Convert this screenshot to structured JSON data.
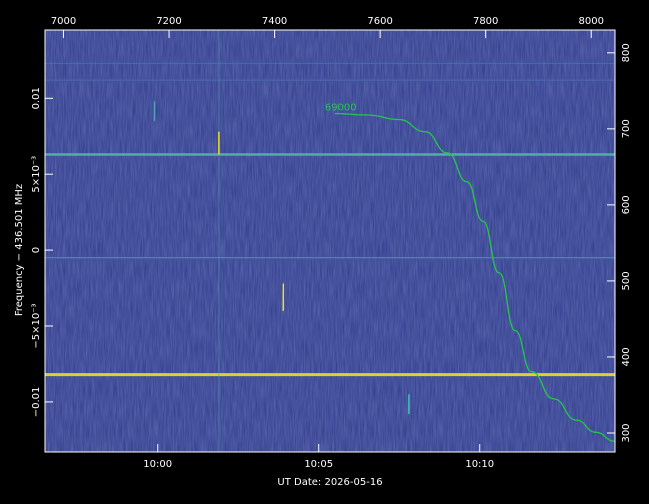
{
  "chart_data": {
    "type": "heatmap",
    "title": "",
    "xlabel": "UT Date: 2026-05-16",
    "ylabel_left": "Frequency − 436.501 MHz",
    "x_bottom": {
      "ticks": [
        "10:00",
        "10:05",
        "10:10"
      ],
      "tick_minutes": [
        0,
        5,
        10
      ],
      "range_minutes": [
        -3.5,
        14.2
      ]
    },
    "x_top": {
      "ticks": [
        "7000",
        "7200",
        "7400",
        "7600",
        "7800",
        "8000"
      ],
      "tick_values": [
        7000,
        7200,
        7400,
        7600,
        7800,
        8000
      ],
      "range": [
        6965,
        8045
      ]
    },
    "y_left": {
      "tick_labels": [
        "0.01",
        "5×10⁻³",
        "0",
        "−5×10⁻³",
        "−0.01"
      ],
      "tick_values": [
        0.01,
        0.005,
        0,
        -0.005,
        -0.01
      ],
      "range": [
        -0.0133,
        0.0145
      ]
    },
    "y_right": {
      "tick_labels": [
        "800",
        "700",
        "600",
        "500",
        "400",
        "300"
      ],
      "tick_values": [
        800,
        700,
        600,
        500,
        400,
        300
      ],
      "range": [
        275,
        830
      ]
    },
    "colors": {
      "background": "#000000",
      "plot_bg": "#2f3a8a",
      "signal": "#22c84a",
      "yellow": "#f0e020",
      "cyan": "#4fa3b8",
      "axis": "#ffffff"
    },
    "signal_curve": {
      "label": "69000",
      "color": "#22c84a",
      "points_minutes_mhzoffset": [
        [
          5.5,
          0.009
        ],
        [
          6.5,
          0.0089
        ],
        [
          7.5,
          0.0086
        ],
        [
          8.3,
          0.0078
        ],
        [
          9.0,
          0.0064
        ],
        [
          9.6,
          0.0045
        ],
        [
          10.1,
          0.0019
        ],
        [
          10.6,
          -0.0015
        ],
        [
          11.1,
          -0.0053
        ],
        [
          11.6,
          -0.008
        ],
        [
          12.3,
          -0.0098
        ],
        [
          13.0,
          -0.0112
        ],
        [
          13.6,
          -0.012
        ],
        [
          14.2,
          -0.0126
        ]
      ]
    },
    "horizontal_lines": [
      {
        "y": 0.0063,
        "color": "#4fb8b0",
        "width": 2.5
      },
      {
        "y": -0.0082,
        "color": "#f0e020",
        "width": 3
      },
      {
        "y": -0.0005,
        "color": "#4f8fc0",
        "width": 1.2
      },
      {
        "y": 0.0123,
        "color": "#4a6fb0",
        "width": 1
      },
      {
        "y": 0.0112,
        "color": "#4a6fb0",
        "width": 1
      }
    ],
    "vertical_lines": [
      {
        "x": 1.9,
        "color": "#4fa3b8",
        "width": 1
      }
    ],
    "spikes": [
      {
        "x": -0.1,
        "y0": 0.0098,
        "y1": 0.0085,
        "color": "#4fa3b8"
      },
      {
        "x": 1.9,
        "y0": 0.0078,
        "y1": 0.0063,
        "color": "#f0e020"
      },
      {
        "x": 3.9,
        "y0": -0.0022,
        "y1": -0.004,
        "color": "#f0e020"
      },
      {
        "x": 7.8,
        "y0": -0.0095,
        "y1": -0.0108,
        "color": "#40c0c0"
      }
    ]
  }
}
